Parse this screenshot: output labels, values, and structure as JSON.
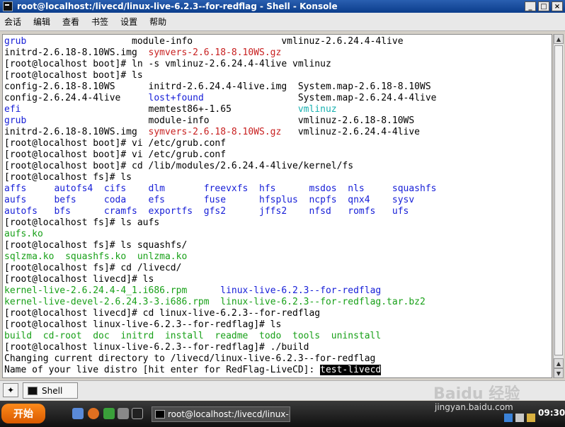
{
  "window": {
    "title": "root@localhost:/livecd/linux-live-6.2.3--for-redflag - Shell - Konsole",
    "controls": [
      "_",
      "□",
      "×"
    ]
  },
  "menu": [
    "会话",
    "编辑",
    "查看",
    "书签",
    "设置",
    "帮助"
  ],
  "terminal": {
    "lines": [
      [
        {
          "t": "grub",
          "c": "blue"
        },
        {
          "t": "                   module-info                vmlinuz-2.6.24.4-4live"
        }
      ],
      [
        {
          "t": "initrd-2.6.18-8.10WS.img  "
        },
        {
          "t": "symvers-2.6.18-8.10WS.gz",
          "c": "red"
        }
      ],
      [
        {
          "t": "[root@localhost boot]# ln -s vmlinuz-2.6.24.4-4live vmlinuz"
        }
      ],
      [
        {
          "t": "[root@localhost boot]# ls"
        }
      ],
      [
        {
          "t": "config-2.6.18-8.10WS      initrd-2.6.24.4-4live.img  System.map-2.6.18-8.10WS"
        }
      ],
      [
        {
          "t": "config-2.6.24.4-4live     "
        },
        {
          "t": "lost+found",
          "c": "blue"
        },
        {
          "t": "                 System.map-2.6.24.4-4live"
        }
      ],
      [
        {
          "t": "efi",
          "c": "blue"
        },
        {
          "t": "                       memtest86+-1.65            "
        },
        {
          "t": "vmlinuz",
          "c": "cyan"
        }
      ],
      [
        {
          "t": "grub",
          "c": "blue"
        },
        {
          "t": "                      module-info                vmlinuz-2.6.18-8.10WS"
        }
      ],
      [
        {
          "t": "initrd-2.6.18-8.10WS.img  "
        },
        {
          "t": "symvers-2.6.18-8.10WS.gz",
          "c": "red"
        },
        {
          "t": "   vmlinuz-2.6.24.4-4live"
        }
      ],
      [
        {
          "t": "[root@localhost boot]# vi /etc/grub.conf"
        }
      ],
      [
        {
          "t": "[root@localhost boot]# vi /etc/grub.conf"
        }
      ],
      [
        {
          "t": "[root@localhost boot]# cd /lib/modules/2.6.24.4-4live/kernel/fs"
        }
      ],
      [
        {
          "t": "[root@localhost fs]# ls"
        }
      ],
      [
        {
          "t": "affs     autofs4  cifs    dlm       freevxfs  hfs      msdos  nls     squashfs",
          "c": "blue"
        }
      ],
      [
        {
          "t": "aufs     befs     coda    efs       fuse      hfsplus  ncpfs  qnx4    sysv",
          "c": "blue"
        }
      ],
      [
        {
          "t": "autofs   bfs      cramfs  exportfs  gfs2      jffs2    nfsd   romfs   ufs",
          "c": "blue"
        }
      ],
      [
        {
          "t": "[root@localhost fs]# ls aufs"
        }
      ],
      [
        {
          "t": "aufs.ko",
          "c": "green"
        }
      ],
      [
        {
          "t": "[root@localhost fs]# ls squashfs/"
        }
      ],
      [
        {
          "t": "sqlzma.ko  squashfs.ko  unlzma.ko",
          "c": "green"
        }
      ],
      [
        {
          "t": "[root@localhost fs]# cd /livecd/"
        }
      ],
      [
        {
          "t": "[root@localhost livecd]# ls"
        }
      ],
      [
        {
          "t": "kernel-live-2.6.24.4-4_1.i686.rpm",
          "c": "green"
        },
        {
          "t": "      "
        },
        {
          "t": "linux-live-6.2.3--for-redflag",
          "c": "blue"
        }
      ],
      [
        {
          "t": "kernel-live-devel-2.6.24.3-3.i686.rpm",
          "c": "green"
        },
        {
          "t": "  "
        },
        {
          "t": "linux-live-6.2.3--for-redflag.tar.bz2",
          "c": "green"
        }
      ],
      [
        {
          "t": "[root@localhost livecd]# cd linux-live-6.2.3--for-redflag"
        }
      ],
      [
        {
          "t": "[root@localhost linux-live-6.2.3--for-redflag]# ls"
        }
      ],
      [
        {
          "t": "build  cd-root  doc  initrd  install  readme  todo  tools  uninstall",
          "c": "green"
        }
      ],
      [
        {
          "t": "[root@localhost linux-live-6.2.3--for-redflag]# ./build"
        }
      ],
      [
        {
          "t": "Changing current directory to /livecd/linux-live-6.2.3--for-redflag"
        }
      ],
      [
        {
          "t": "Name of your live distro [hit enter for RedFlag-LiveCD]: "
        },
        {
          "t": "test-livecd",
          "c": "sel"
        }
      ]
    ]
  },
  "tabbar": {
    "tab_label": "Shell",
    "watermark": "Baidu 经验"
  },
  "taskbar": {
    "start_label": "开始",
    "task_label": "root@localhost:/livecd/linux-li",
    "tray_text": "jingyan.baidu.com",
    "clock": "09:30"
  }
}
